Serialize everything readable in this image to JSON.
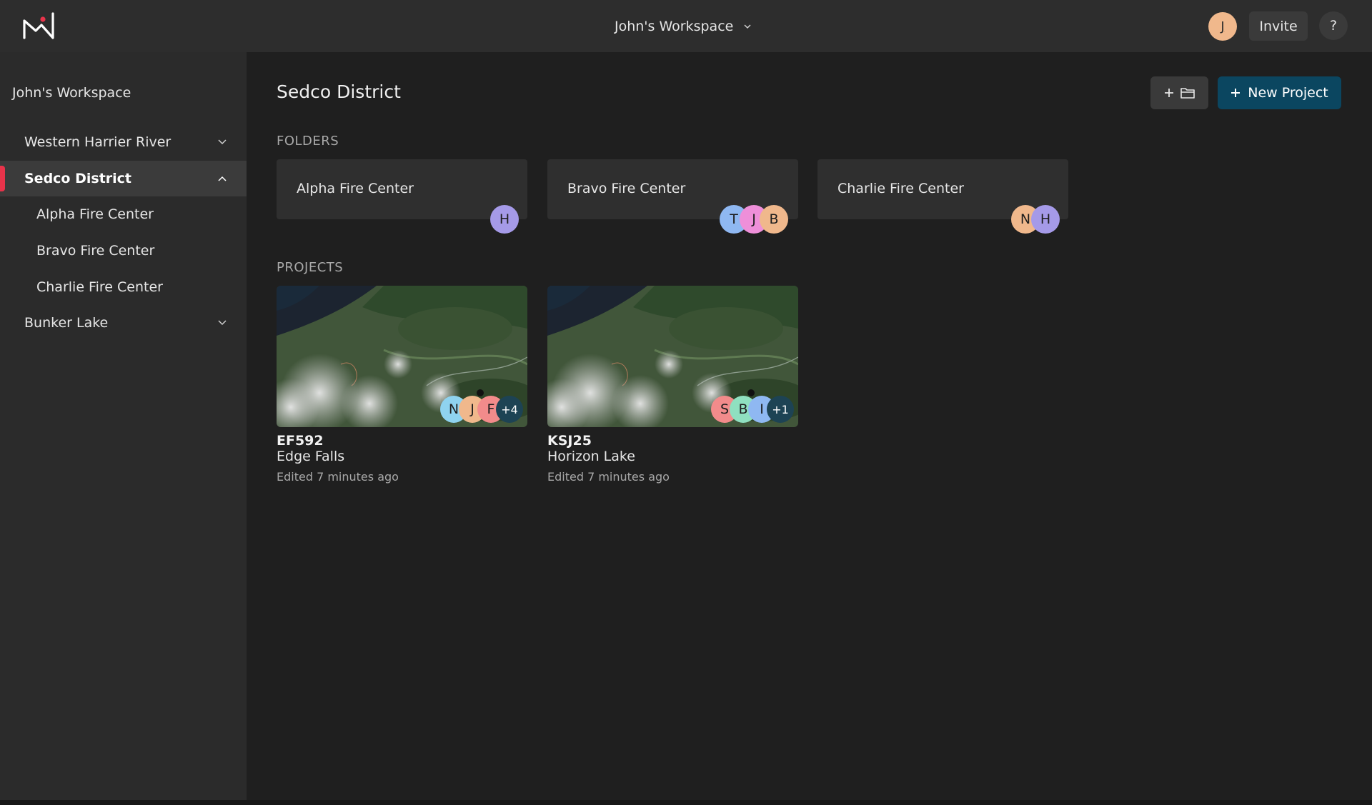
{
  "topbar": {
    "logo_icon": "signal-logo-icon",
    "workspace_label": "John's Workspace",
    "user_initial": "J",
    "invite_label": "Invite",
    "help_label": "?"
  },
  "sidebar": {
    "title": "John's Workspace",
    "items": [
      {
        "label": "Western Harrier River",
        "expanded": false,
        "level": 0
      },
      {
        "label": "Sedco District",
        "expanded": true,
        "level": 0,
        "active": true
      },
      {
        "label": "Alpha Fire Center",
        "level": 1
      },
      {
        "label": "Bravo Fire Center",
        "level": 1
      },
      {
        "label": "Charlie Fire Center",
        "level": 1
      },
      {
        "label": "Bunker Lake",
        "expanded": false,
        "level": 0
      }
    ]
  },
  "main": {
    "title": "Sedco District",
    "new_folder_icon": "plus-folder-icon",
    "new_project_label": "New Project",
    "folders_label": "FOLDERS",
    "projects_label": "PROJECTS",
    "folders": [
      {
        "name": "Alpha Fire Center",
        "members": [
          {
            "initial": "H",
            "color": "#a59ae8"
          }
        ]
      },
      {
        "name": "Bravo Fire Center",
        "members": [
          {
            "initial": "T",
            "color": "#8fb8f2"
          },
          {
            "initial": "J",
            "color": "#ee8fd9"
          },
          {
            "initial": "B",
            "color": "#f0b88c"
          }
        ]
      },
      {
        "name": "Charlie Fire Center",
        "members": [
          {
            "initial": "N",
            "color": "#f0b88c"
          },
          {
            "initial": "H",
            "color": "#a59ae8"
          }
        ]
      }
    ],
    "projects": [
      {
        "code": "EF592",
        "name": "Edge Falls",
        "edited": "Edited 7 minutes ago",
        "members": [
          {
            "initial": "N",
            "color": "#8fd3f0"
          },
          {
            "initial": "J",
            "color": "#f0b88c"
          },
          {
            "initial": "F",
            "color": "#f28b8b"
          }
        ],
        "more": "+4"
      },
      {
        "code": "KSJ25",
        "name": "Horizon Lake",
        "edited": "Edited 7 minutes ago",
        "members": [
          {
            "initial": "S",
            "color": "#f28b8b"
          },
          {
            "initial": "B",
            "color": "#8fe0c0"
          },
          {
            "initial": "I",
            "color": "#8fb8f2"
          }
        ],
        "more": "+1"
      }
    ]
  }
}
